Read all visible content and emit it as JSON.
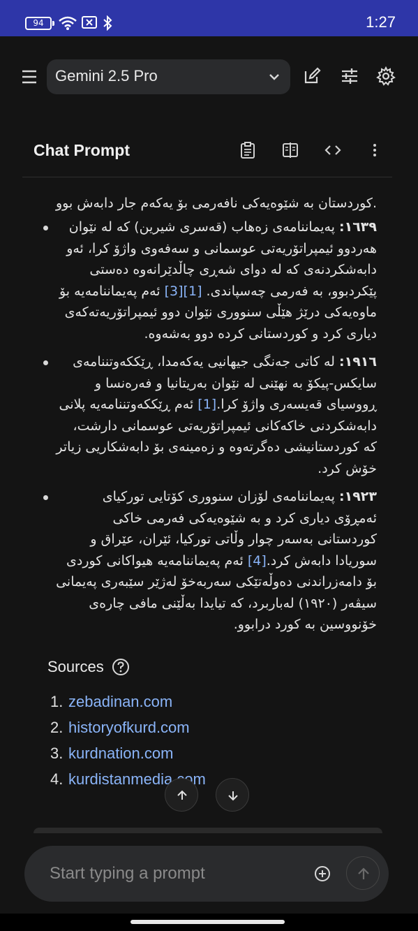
{
  "status_bar": {
    "battery": "94",
    "time": "1:27"
  },
  "header": {
    "model": "Gemini 2.5 Pro"
  },
  "panel": {
    "title": "Chat Prompt"
  },
  "content": {
    "top_line": ".کوردستان بە شێوەیەکی نافەرمی بۆ یەکەم جار دابەش بوو",
    "bullets": [
      {
        "year": "١٦٣٩:",
        "text": " پەیماننامەی زەهاب (قەسری شیرین) کە لە نێوان هەردوو ئیمپراتۆریەتی عوسمانی و سەفەوی واژۆ کرا، ئەو دابەشکردنەی کە لە دوای شەڕی چاڵدێرانەوە دەستی پێکردبوو، بە فەرمی چەسپاندی.",
        "cites": "[1][3]",
        "after": " ئەم پەیماننامەیە بۆ ماوەیەکی درێژ هێڵی سنووری نێوان دوو ئیمپراتۆریەتەکەی دیاری کرد و کوردستانی کردە دوو بەشەوە."
      },
      {
        "year": "١٩١٦:",
        "text": " لە کاتی جەنگی جیهانیی یەکەمدا، ڕێککەوتننامەی سایکس-پیکۆ بە نهێنی لە نێوان بەریتانیا و فەرەنسا و ڕووسیای قەیسەری واژۆ کرا.",
        "cites": "[1]",
        "after": " ئەم ڕێککەوتننامەیە پلانی دابەشکردنی خاکەکانی ئیمپراتۆریەتی عوسمانی دارشت، کە کوردستانیشی دەگرتەوە و زەمینەی بۆ دابەشکاریی زیاتر خۆش کرد."
      },
      {
        "year": "١٩٢٣:",
        "text": " پەیماننامەی لۆزان سنووری کۆتایی تورکیای ئەمڕۆی دیاری کرد و بە شێوەیەکی فەرمی خاکی کوردستانی بەسەر چوار وڵاتی تورکیا، ئێران، عێراق و سوریادا دابەش کرد.",
        "cites": "[4]",
        "after": " ئەم پەیماننامەیە هیواکانی کوردی بۆ دامەزراندنی دەوڵەتێکی سەربەخۆ لەژێر سێبەری پەیمانی سیڤەر (١٩٢٠) لەباربرد، کە تیایدا بەڵێنی مافی چارەی خۆنووسین بە کورد درابوو."
      }
    ]
  },
  "sources": {
    "title": "Sources",
    "items": [
      {
        "num": "1.",
        "label": "zebadinan.com"
      },
      {
        "num": "2.",
        "label": "historyofkurd.com"
      },
      {
        "num": "3.",
        "label": "kurdnation.com"
      },
      {
        "num": "4.",
        "label": "kurdistanmedia.com"
      }
    ]
  },
  "composer": {
    "placeholder": "Start typing a prompt"
  },
  "colors": {
    "status_bar": "#2e36a8",
    "background": "#141414",
    "link": "#8ab4f8",
    "surface": "#2a2b2d"
  }
}
